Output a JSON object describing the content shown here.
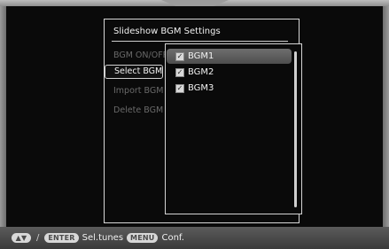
{
  "dialog": {
    "title": "Slideshow BGM Settings",
    "menu": [
      {
        "label": "BGM ON/OFF",
        "selected": false
      },
      {
        "label": "Select BGM",
        "selected": true
      },
      {
        "label": "Import BGM",
        "selected": false
      },
      {
        "label": "Delete BGM",
        "selected": false
      }
    ]
  },
  "bgm_list": {
    "items": [
      {
        "label": "BGM1",
        "checked": true,
        "highlighted": true
      },
      {
        "label": "BGM2",
        "checked": true,
        "highlighted": false
      },
      {
        "label": "BGM3",
        "checked": true,
        "highlighted": false
      }
    ],
    "check_glyph": "✓"
  },
  "bottom_bar": {
    "arrows_glyph": "▲▼",
    "separator": "/",
    "enter_label": "ENTER",
    "enter_action": "Sel.tunes",
    "menu_label": "MENU",
    "menu_action": "Conf."
  }
}
